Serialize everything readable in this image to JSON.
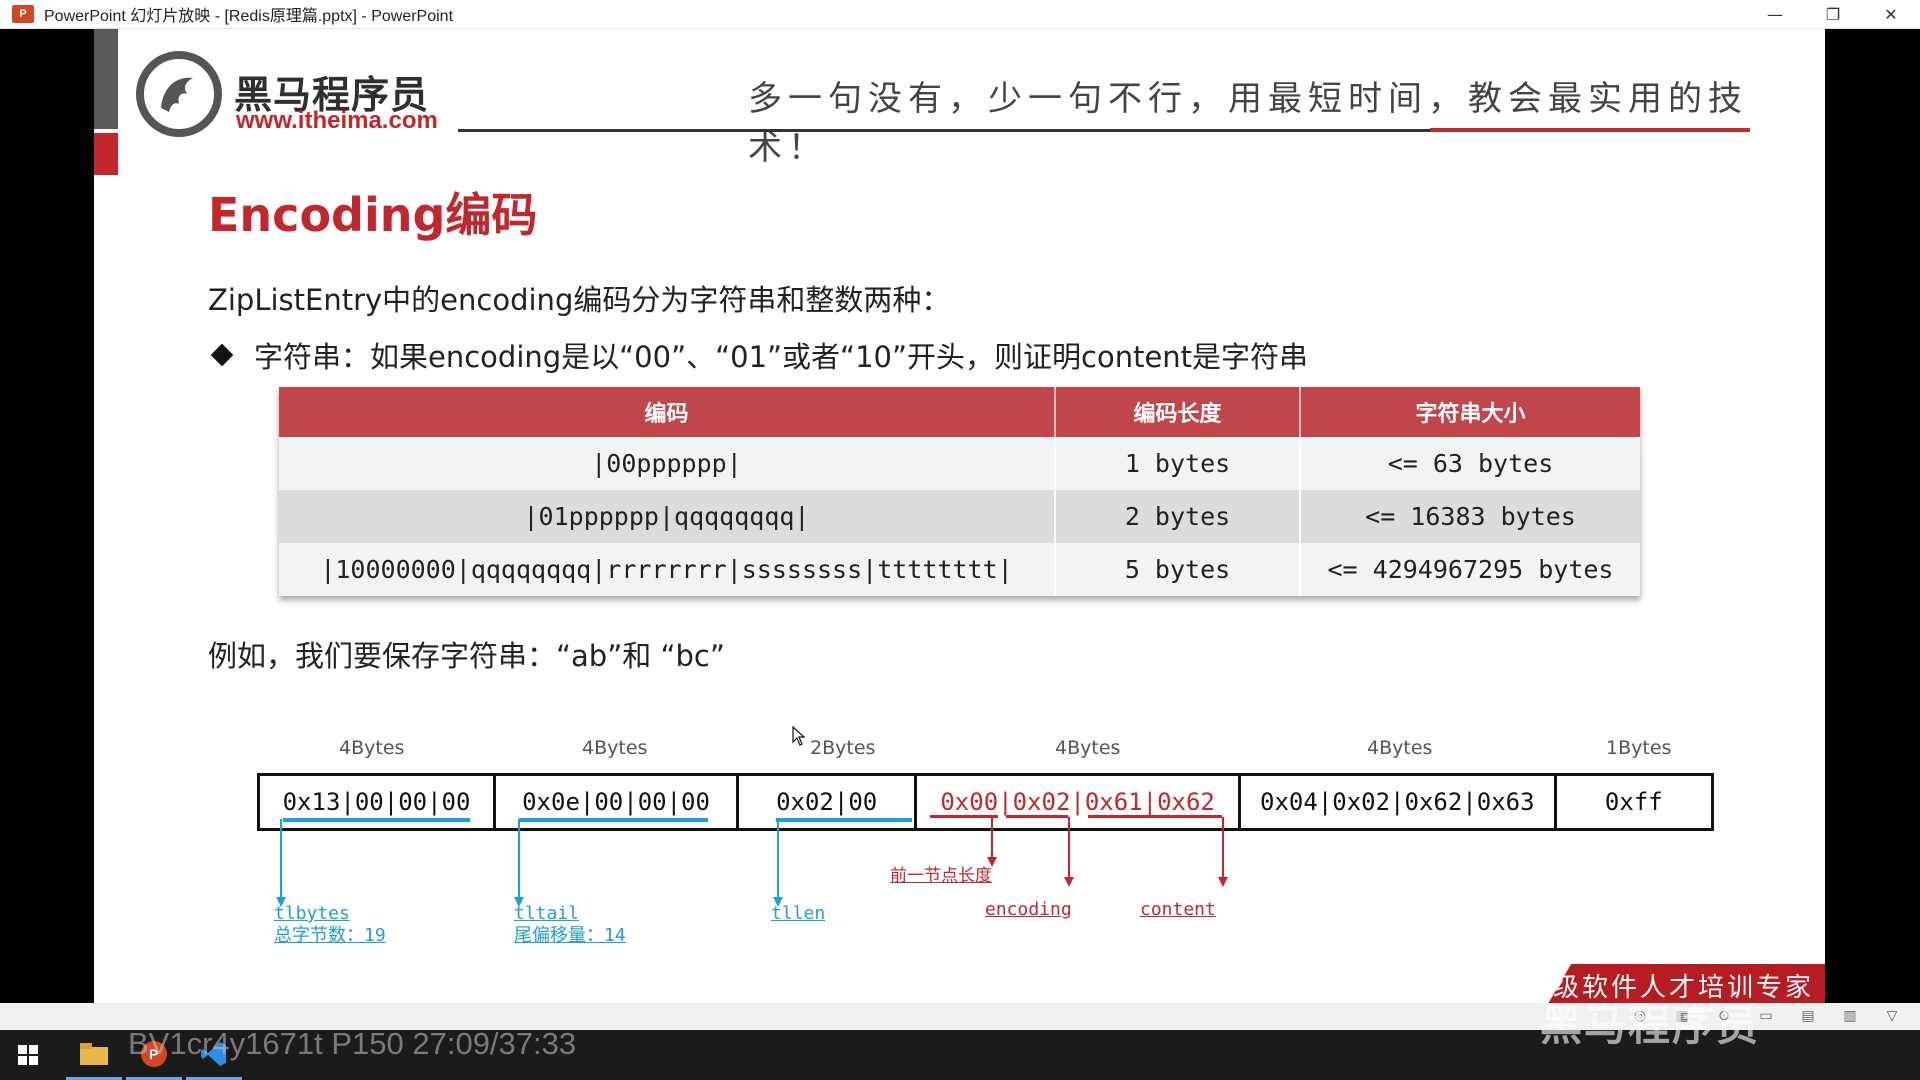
{
  "window": {
    "title": "PowerPoint 幻灯片放映 - [Redis原理篇.pptx] - PowerPoint",
    "app_icon_label": "P",
    "controls": {
      "minimize": "—",
      "restore": "❐",
      "close": "✕"
    }
  },
  "slide": {
    "logo": {
      "name": "黑马程序员",
      "url": "www.itheima.com"
    },
    "slogan": "多一句没有，少一句不行，用最短时间，教会最实用的技术！",
    "heading": "Encoding编码",
    "intro": "ZipListEntry中的encoding编码分为字符串和整数两种：",
    "bullet": "字符串：如果encoding是以“00”、“01”或者“10”开头，则证明content是字符串",
    "table": {
      "headers": [
        "编码",
        "编码长度",
        "字符串大小"
      ],
      "rows": [
        [
          "|00pppppp|",
          "1 bytes",
          "<= 63 bytes"
        ],
        [
          "|01pppppp|qqqqqqqq|",
          "2 bytes",
          "<= 16383 bytes"
        ],
        [
          "|10000000|qqqqqqqq|rrrrrrrr|ssssssss|tttttttt|",
          "5 bytes",
          "<= 4294967295 bytes"
        ]
      ]
    },
    "example": "例如，我们要保存字符串：“ab”和 “bc”",
    "diagram": {
      "sizes": [
        "4Bytes",
        "4Bytes",
        "2Bytes",
        "4Bytes",
        "4Bytes",
        "1Bytes"
      ],
      "cells": [
        "0x13|00|00|00",
        "0x0e|00|00|00",
        "0x02|00",
        "0x00|0x02|0x61|0x62",
        "0x04|0x02|0x62|0x63",
        "0xff"
      ],
      "annotations": {
        "tlbytes": "tlbytes",
        "tlbytes_desc": "总字节数：19",
        "tltail": "tltail",
        "tltail_desc": "尾偏移量：14",
        "tllen": "tllen",
        "prev_len": "前一节点长度",
        "encoding": "encoding",
        "content": "content"
      }
    },
    "banner": "高级软件人才培训专家"
  },
  "overlay": {
    "watermark_left": "BV1cr4y1671t P150 27:09/37:33",
    "watermark_right": "黑马程序员"
  },
  "colors": {
    "accent_red": "#c1272d",
    "table_header": "#c0464c",
    "annotation_blue": "#1e9fd6"
  }
}
